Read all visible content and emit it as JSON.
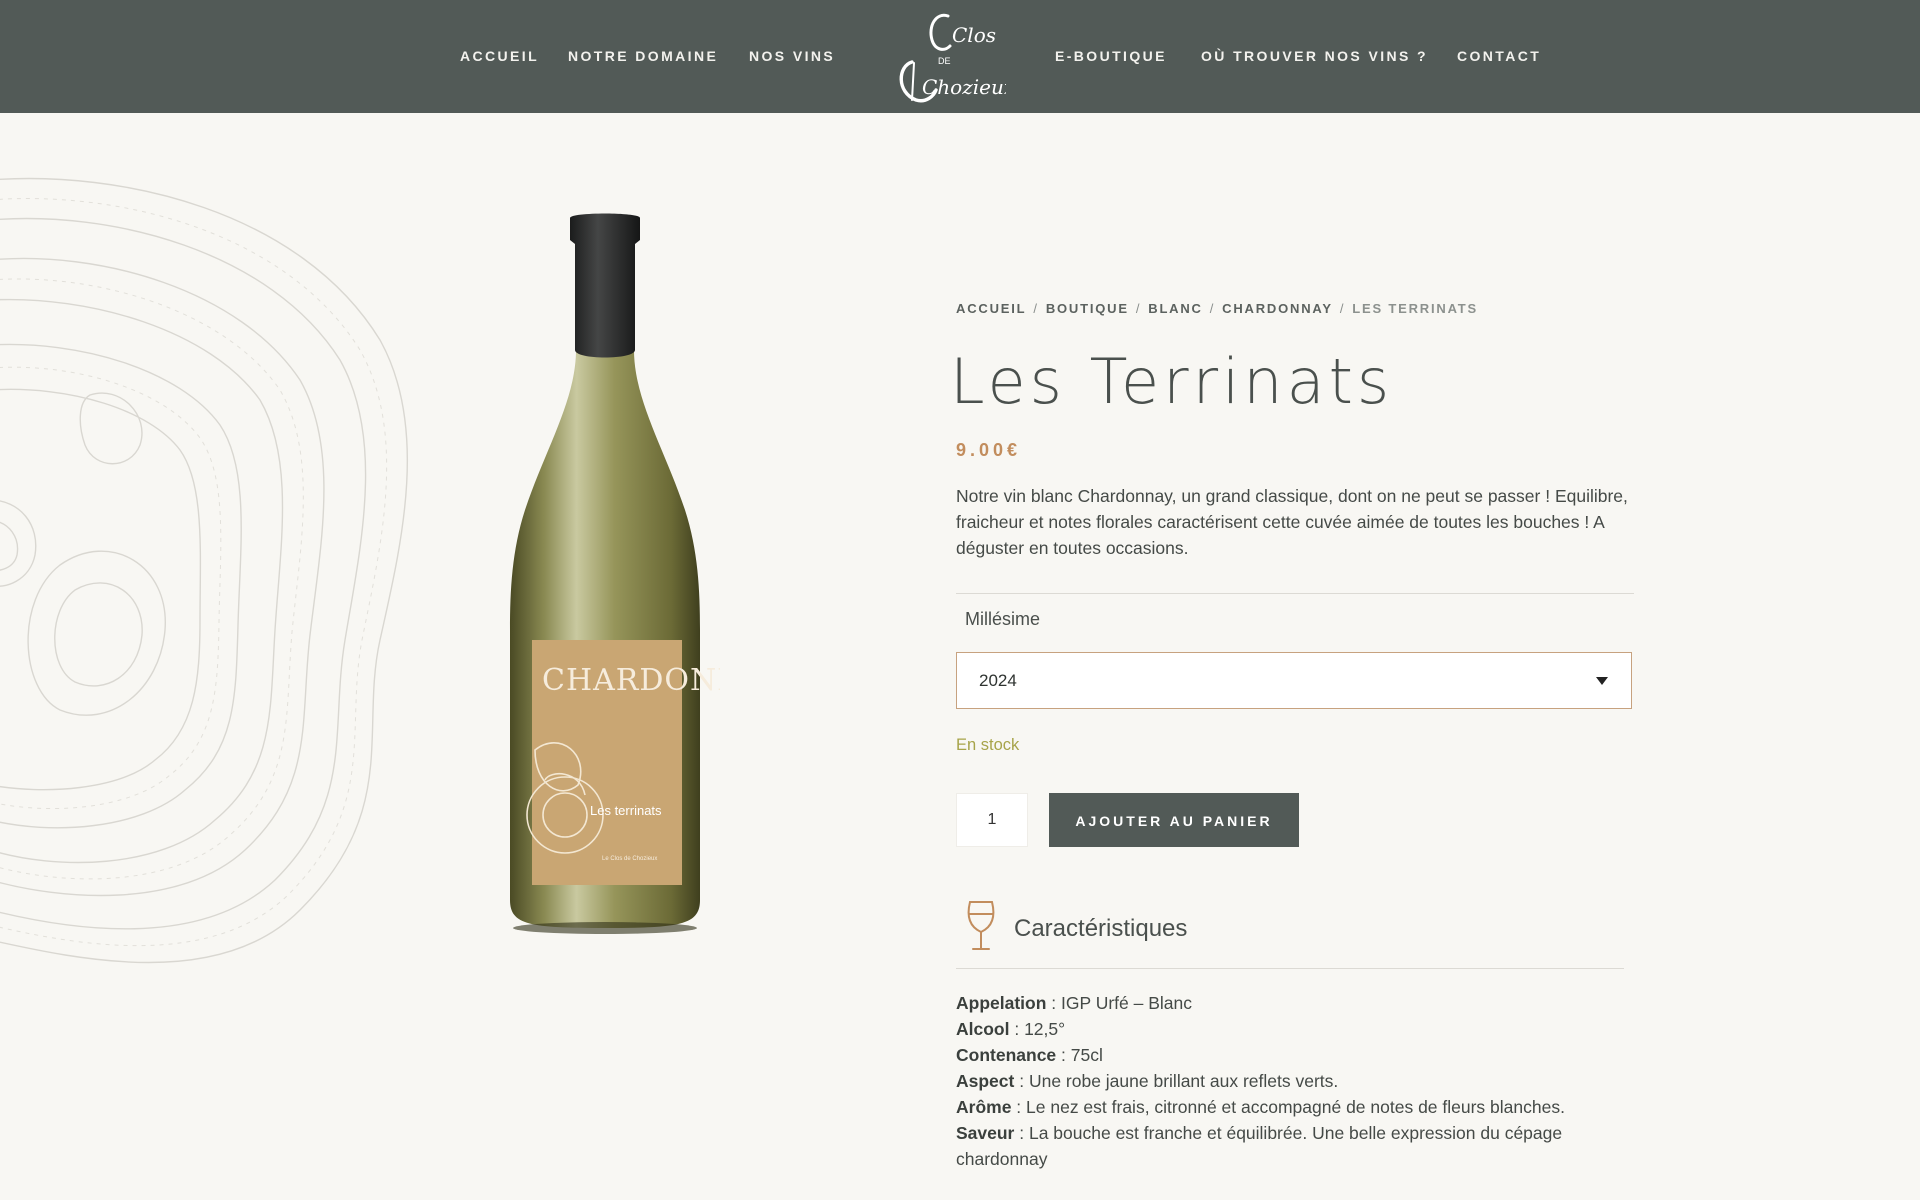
{
  "nav": {
    "left": [
      "ACCUEIL",
      "NOTRE DOMAINE",
      "NOS VINS"
    ],
    "right": [
      "E-BOUTIQUE",
      "OÙ TROUVER NOS VINS ?",
      "CONTACT"
    ]
  },
  "logo": {
    "line1": "Clos",
    "line2": "DE",
    "line3": "Chozieux"
  },
  "breadcrumb": {
    "items": [
      "ACCUEIL",
      "BOUTIQUE",
      "BLANC",
      "CHARDONNAY"
    ],
    "separator": "/",
    "current": "LES TERRINATS"
  },
  "product": {
    "title": "Les Terrinats",
    "price": "9.00€",
    "description": "Notre vin blanc Chardonnay, un grand classique, dont on ne peut se passer ! Equilibre, fraicheur et notes florales caractérisent cette cuvée aimée de toutes les bouches ! A déguster en toutes occasions.",
    "vintage_label": "Millésime",
    "vintage_value": "2024",
    "stock": "En stock",
    "quantity": "1",
    "add_to_cart": "AJOUTER AU PANIER"
  },
  "bottle_label": {
    "varietal": "CHARDONNAY",
    "cuvee": "Les terrinats",
    "producer": "Le Clos de Chozieux"
  },
  "characteristics": {
    "title": "Caractéristiques",
    "items": [
      {
        "key": "Appelation",
        "value": " : IGP Urfé – Blanc"
      },
      {
        "key": "Alcool",
        "value": " : 12,5°"
      },
      {
        "key": "Contenance",
        "value": " : 75cl"
      },
      {
        "key": "Aspect",
        "value": " : Une robe jaune brillant aux reflets verts."
      },
      {
        "key": "Arôme",
        "value": " : Le nez est frais, citronné et accompagné de notes de fleurs blanches."
      },
      {
        "key": "Saveur",
        "value": " : La bouche est franche et équilibrée. Une belle expression du cépage chardonnay"
      }
    ]
  },
  "colors": {
    "header": "#525a57",
    "background": "#f8f7f3",
    "price": "#c28d5d",
    "stock": "#a7a44a",
    "select_border": "#c7a27f"
  },
  "icons": {
    "select_caret": "caret-down-icon",
    "characteristics": "wine-glass-icon"
  }
}
